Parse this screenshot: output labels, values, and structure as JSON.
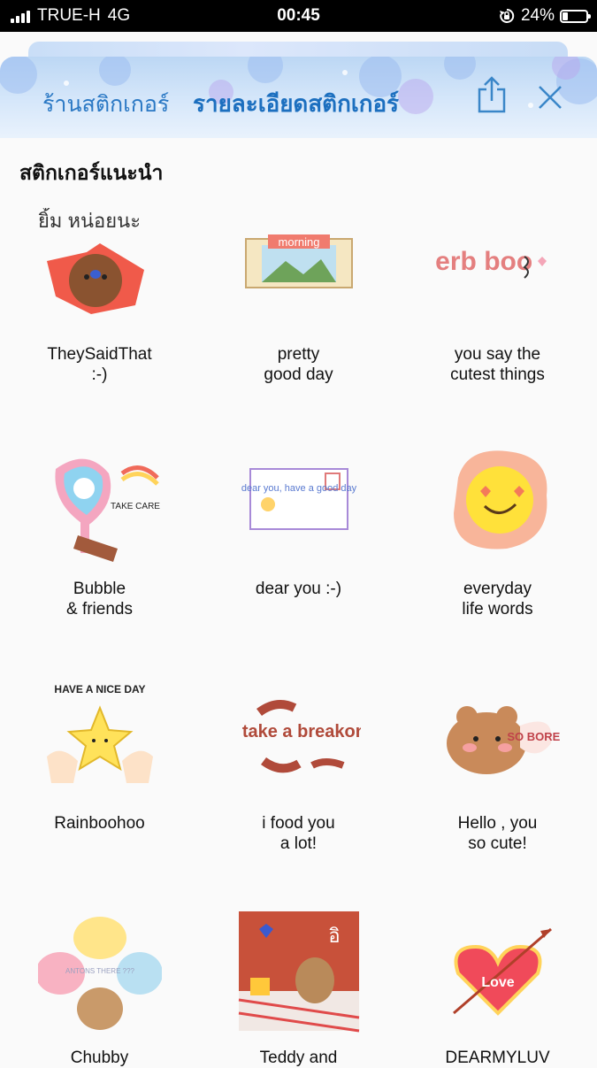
{
  "status_bar": {
    "carrier": "TRUE-H",
    "network": "4G",
    "time": "00:45",
    "battery": "24%",
    "battery_level": 0.24
  },
  "header": {
    "tab_store": "ร้านสติกเกอร์",
    "tab_detail": "รายละเอียดสติกเกอร์"
  },
  "section_title": "สติกเกอร์แนะนำ",
  "stickers": [
    {
      "label": "TheySaidThat\n:-)",
      "text_art": "ยิ้ม หน่อยนะ"
    },
    {
      "label": "pretty\ngood day",
      "text_art": "morning"
    },
    {
      "label": "you say the\ncutest things",
      "text_art": "berb boo"
    },
    {
      "label": "Bubble\n& friends",
      "text_art": "TAKE CARE"
    },
    {
      "label": "dear you :-)",
      "text_art": "dear you, have a good day"
    },
    {
      "label": "everyday\nlife words",
      "text_art": ""
    },
    {
      "label": "Rainboohoo",
      "text_art": "HAVE A NICE DAY"
    },
    {
      "label": "i food you\na lot!",
      "text_art": "take a breakon !"
    },
    {
      "label": "Hello , you\nso cute!",
      "text_art": "SO BORED"
    },
    {
      "label": "Chubby",
      "text_art": "ANTONS THERE ???"
    },
    {
      "label": "Teddy and",
      "text_art": "อิ"
    },
    {
      "label": "DEARMYLUV",
      "text_art": "Love"
    }
  ],
  "colors": {
    "accent": "#1c6fbf",
    "header_bg": "#d6e7fa",
    "page_bg": "#fafafa"
  }
}
